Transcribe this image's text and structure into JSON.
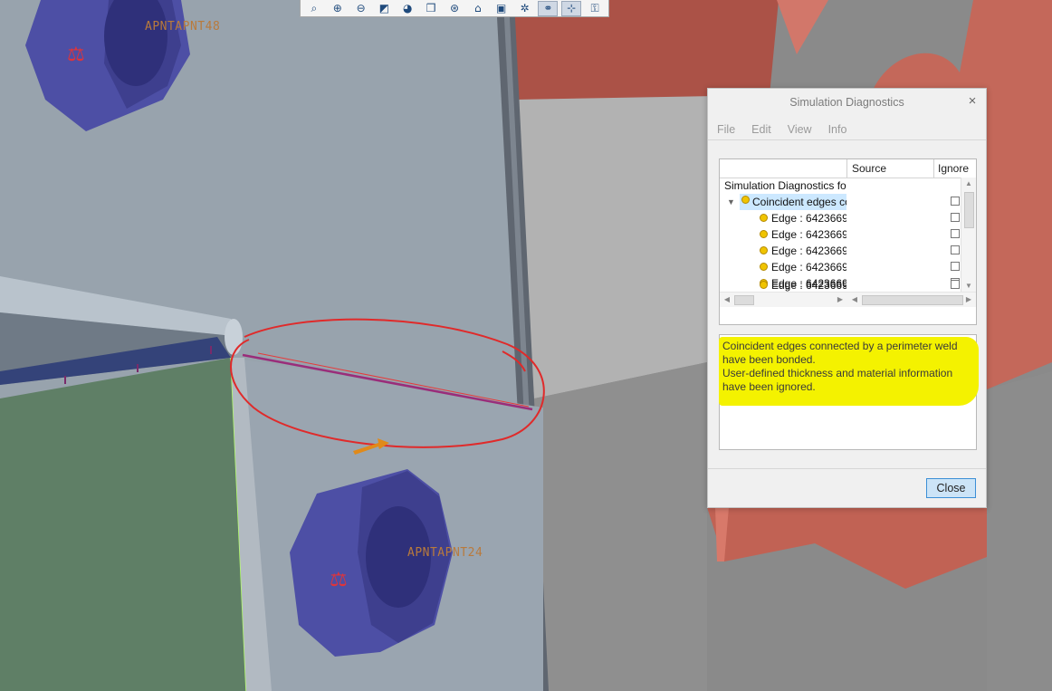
{
  "toolbar": {
    "buttons": [
      {
        "icon": "zoom-window-icon",
        "glyph": "⌕"
      },
      {
        "icon": "zoom-in-icon",
        "glyph": "⊕"
      },
      {
        "icon": "zoom-out-icon",
        "glyph": "⊖"
      },
      {
        "icon": "repaint-icon",
        "glyph": "◩"
      },
      {
        "icon": "display-style-icon",
        "glyph": "◕"
      },
      {
        "icon": "saved-orientations-icon",
        "glyph": "❒"
      },
      {
        "icon": "view-manager-icon",
        "glyph": "⊛"
      },
      {
        "icon": "perspective-view-icon",
        "glyph": "⌂"
      },
      {
        "icon": "appearance-icon",
        "glyph": "▣"
      },
      {
        "icon": "datum-display-icon",
        "glyph": "✲"
      },
      {
        "icon": "annotation-display-icon",
        "glyph": "⚭"
      },
      {
        "icon": "spin-center-icon",
        "glyph": "⊹"
      },
      {
        "icon": "simulation-display-icon",
        "glyph": "⚿"
      }
    ]
  },
  "viewport": {
    "label_top": "APNTAPNT48",
    "label_bottom": "APNTAPNT24",
    "weld_symbol": "⚖"
  },
  "dialog": {
    "title": "Simulation Diagnostics",
    "close_x": "×",
    "menu": [
      "File",
      "Edit",
      "View",
      "Info"
    ],
    "columns": {
      "name": "",
      "source": "Source",
      "ignore": "Ignore"
    },
    "tree": {
      "root": "Simulation Diagnostics fo",
      "group": "Coincident edges co",
      "children": [
        "Edge : 6423669_",
        "Edge : 6423669_",
        "Edge : 6423669_",
        "Edge : 6423669_",
        "Edge : 6423669_",
        "Edge : 6423669_"
      ]
    },
    "info": {
      "lines": [
        "Coincident edges connected by a perimeter weld",
        "have been bonded.",
        "User-defined thickness and material information",
        "have been ignored."
      ]
    },
    "close_button": "Close"
  },
  "colors": {
    "plate": "#98a3ad",
    "bracket": "#b65a4c",
    "washer": "#4d4fa5",
    "green_face": "#5f7f66",
    "highlight": "#f4f200",
    "sketch_red": "#e02a2a"
  }
}
